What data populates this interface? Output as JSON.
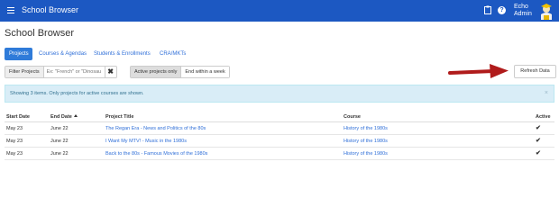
{
  "header": {
    "title": "School Browser",
    "user": "Echo Admin",
    "icons": [
      "menu-icon",
      "clipboard-icon",
      "help-icon",
      "avatar"
    ]
  },
  "page": {
    "title": "School Browser"
  },
  "tabs": [
    {
      "label": "Projects",
      "active": true
    },
    {
      "label": "Courses & Agendas",
      "active": false
    },
    {
      "label": "Students & Enrollments",
      "active": false
    },
    {
      "label": "CRA/MKTs",
      "active": false
    }
  ],
  "filter": {
    "label": "Filter Projects",
    "placeholder": "Ex: \"French\" or \"Dinosau",
    "clear": "✖"
  },
  "toggles": {
    "active_only": "Active projects only",
    "end_within_week": "End within a week"
  },
  "refresh_label": "Refresh Data",
  "info": {
    "message": "Showing 3 items.  Only projects for active courses are shown.",
    "close": "×"
  },
  "table": {
    "headers": [
      "Start Date",
      "End Date",
      "Project Title",
      "Course",
      "Active"
    ],
    "rows": [
      {
        "start": "May 23",
        "end": "June 22",
        "title": "The Regan Era - News and Politics of the 80s",
        "course": "History of the 1980s",
        "active": "✔"
      },
      {
        "start": "May 23",
        "end": "June 22",
        "title": "I Want My MTV! - Music in the 1980s",
        "course": "History of the 1980s",
        "active": "✔"
      },
      {
        "start": "May 23",
        "end": "June 22",
        "title": "Back to the 80s - Famous Movies of the 1980s",
        "course": "History of the 1980s",
        "active": "✔"
      }
    ]
  },
  "colors": {
    "topbar": "#1c58c2",
    "tab_active": "#2f7bd9",
    "link": "#2f6fd8",
    "info_bg": "#d9edf7",
    "arrow": "#b01b1b"
  }
}
